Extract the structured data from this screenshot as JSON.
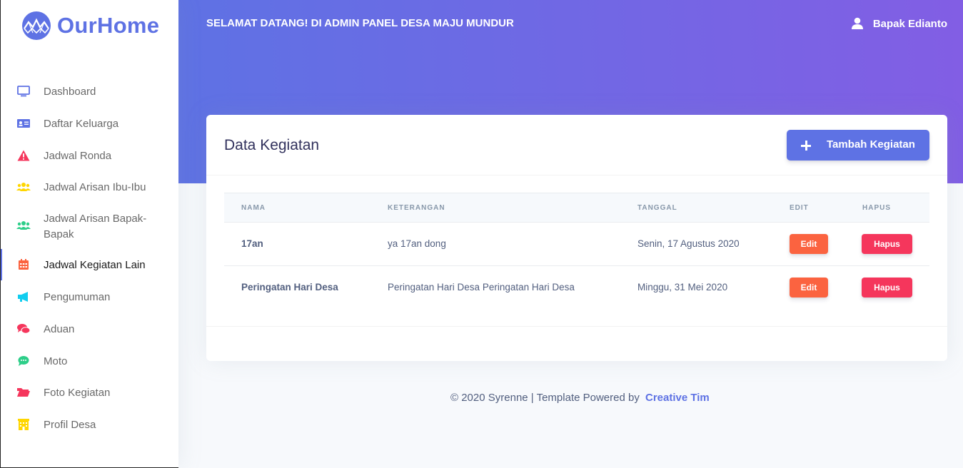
{
  "brand": {
    "name": "OurHome"
  },
  "header": {
    "welcome": "SELAMAT DATANG! DI ADMIN PANEL DESA MAJU MUNDUR",
    "user_name": "Bapak Edianto"
  },
  "sidebar": {
    "items": [
      {
        "label": "Dashboard",
        "icon": "monitor-icon",
        "color": "#5e72e4"
      },
      {
        "label": "Daftar Keluarga",
        "icon": "id-card-icon",
        "color": "#5e72e4"
      },
      {
        "label": "Jadwal Ronda",
        "icon": "warning-icon",
        "color": "#f5365c"
      },
      {
        "label": "Jadwal Arisan Ibu-Ibu",
        "icon": "users-icon",
        "color": "#ffd600"
      },
      {
        "label": "Jadwal Arisan Bapak-Bapak",
        "icon": "users-icon",
        "color": "#2dce89"
      },
      {
        "label": "Jadwal Kegiatan Lain",
        "icon": "calendar-icon",
        "color": "#fb6340",
        "active": true
      },
      {
        "label": "Pengumuman",
        "icon": "megaphone-icon",
        "color": "#11cdef"
      },
      {
        "label": "Aduan",
        "icon": "chat-icon",
        "color": "#f5365c"
      },
      {
        "label": "Moto",
        "icon": "speech-bubble-icon",
        "color": "#2dce89"
      },
      {
        "label": "Foto Kegiatan",
        "icon": "folder-icon",
        "color": "#f5365c"
      },
      {
        "label": "Profil Desa",
        "icon": "building-icon",
        "color": "#ffd600"
      }
    ]
  },
  "card": {
    "title": "Data Kegiatan",
    "add_button": "Tambah Kegiatan",
    "columns": [
      "NAMA",
      "KETERANGAN",
      "TANGGAL",
      "EDIT",
      "HAPUS"
    ],
    "rows": [
      {
        "nama": "17an",
        "keterangan": "ya 17an dong",
        "tanggal": "Senin, 17 Agustus 2020",
        "edit": "Edit",
        "hapus": "Hapus"
      },
      {
        "nama": "Peringatan Hari Desa",
        "keterangan": "Peringatan Hari Desa Peringatan Hari Desa",
        "tanggal": "Minggu, 31 Mei 2020",
        "edit": "Edit",
        "hapus": "Hapus"
      }
    ]
  },
  "footer": {
    "text": "© 2020 Syrenne | Template Powered by ",
    "link": "Creative Tim"
  },
  "colors": {
    "primary": "#5e72e4",
    "gradient_end": "#825ee4",
    "warning": "#fb6340",
    "danger": "#f5365c"
  }
}
